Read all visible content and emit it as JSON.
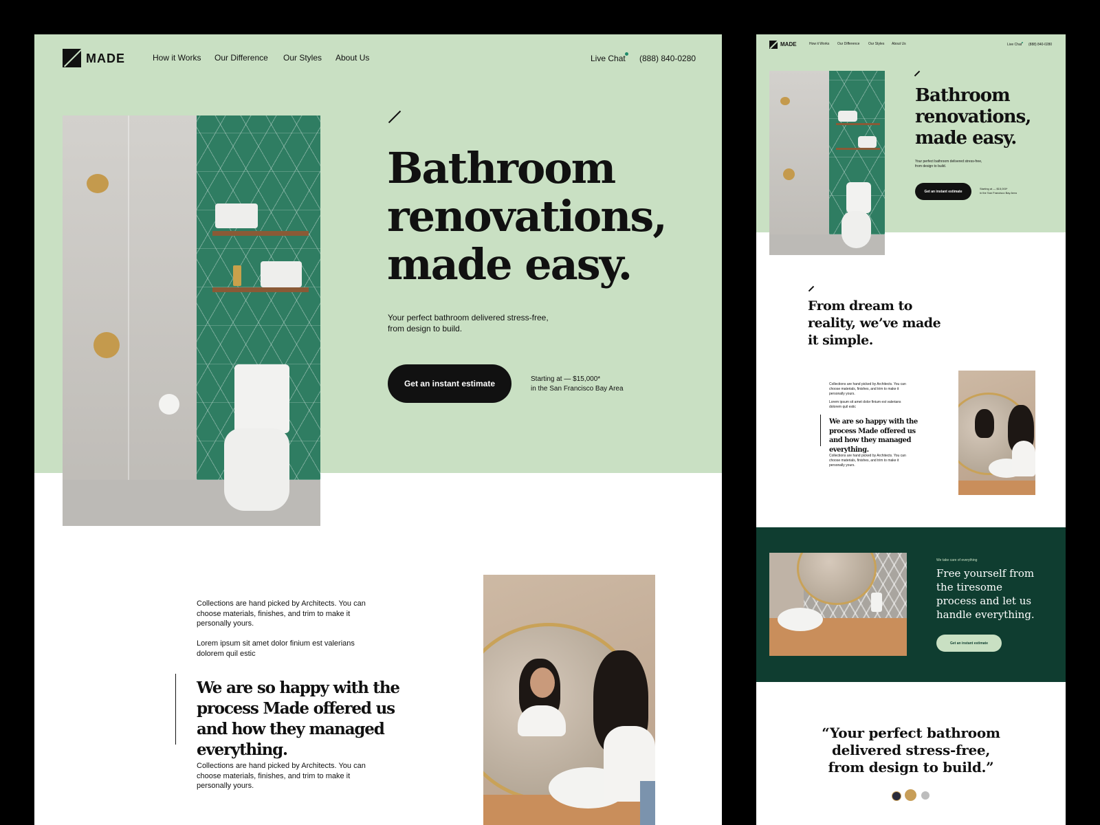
{
  "brand": {
    "name": "MADE"
  },
  "nav": {
    "links": [
      "How it Works",
      "Our Difference",
      "Our Styles",
      "About Us"
    ],
    "live_chat": "Live Chat",
    "phone": "(888) 840-0280"
  },
  "hero": {
    "headline_lines": [
      "Bathroom",
      "renovations,",
      "made easy."
    ],
    "subtitle": "Your perfect bathroom delivered stress-free, from design to build.",
    "cta": "Get an instant estimate",
    "price_line1": "Starting at — $15,000*",
    "price_line2": "in the San Francisco Bay Area"
  },
  "section2": {
    "heading": "From dream to reality, we’ve made it simple.",
    "para1": "Collections are hand picked by Architects. You can choose materials, finishes, and trim to make it personally yours.",
    "para2": "Lorem ipsum sit amet dolor finium est valerians dolorem quil estic",
    "quote": "We are so happy with the process Made offered us and how they managed everything.",
    "para3": "Collections are hand picked by Architects. You can choose materials, finishes, and trim to make it personally yours."
  },
  "section3": {
    "eyebrow": "We take care of everything",
    "heading": "Free yourself from the tiresome process and let us handle everything.",
    "cta": "Get an instant estimate"
  },
  "section4": {
    "quote": "“Your perfect bathroom delivered stress-free, from design to build.”"
  },
  "colors": {
    "mint": "#c9e0c3",
    "dark_green": "#0f3d30",
    "tile_green": "#2f7d62",
    "ink": "#111111",
    "live_dot": "#1f8a6a"
  },
  "icons": [
    "logo-mark-icon",
    "slash-accent-icon",
    "live-chat-dot-icon"
  ]
}
